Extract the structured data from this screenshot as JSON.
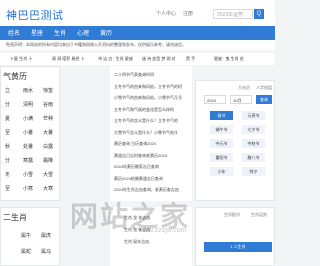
{
  "header": {
    "logo": "神巴巴测试",
    "search_placeholder": "2023年运势",
    "search_btn": "Q",
    "links": [
      "个人中心",
      "注册"
    ]
  },
  "nav": [
    "姓名",
    "星座",
    "生肖",
    "心理",
    "黄历"
  ],
  "notice": {
    "text": "免责声明：本网站的所有内容均来自于书籍和网络公开资料的整理和发布，仅供娱乐参考，请勿迷信。",
    "highlight": "仅供娱乐参考，请勿迷信。"
  },
  "tags": [
    "卜星 生肖 十",
    "周 测 塔罗 易经 卜 ",
    "冲 洁 白 · 生肖 星座",
    "迷 诗 血型 梦 测 对",
    "黑 手",
    "星座 · 鬼 生肖 花"
  ],
  "solar_terms": {
    "title": "气黄历",
    "grid": [
      [
        "立",
        "雨水",
        "惊蛰"
      ],
      [
        "分",
        "清明",
        "谷雨"
      ],
      [
        "夏",
        "小满",
        "芒种"
      ],
      [
        "至",
        "小暑",
        "大暑"
      ],
      [
        "秋",
        "处暑",
        "白露"
      ],
      [
        "分",
        "寒露",
        "霜降"
      ],
      [
        "冬",
        "小雪",
        "大雪"
      ],
      [
        "至",
        "小寒",
        "大寒"
      ]
    ]
  },
  "articles": {
    "title": "气黄历",
    "items": [
      "二十四节气表查询时间",
      "立冬节气的由来和风俗，立冬节气的时",
      "小雪节气的由来和风俗，小雪节气几号",
      "立冬节气和气候的变化是怎么样的",
      "立冬节气的含义是什么？立冬节气的",
      "大雪节气含义是什么？小寒节气吃什",
      "黄历查询 日历查询2024",
      "黄道吉日吉时查询老黄历2024",
      "2024年黄历搬家吉日查询",
      "黄历2024结婚黄道吉日查询",
      "2024年生肖吉凶查询，老黄历查吉凶"
    ]
  },
  "right": {
    "tab1": "万年历",
    "tab2": "八字排盘",
    "year": "2024",
    "month": "10月",
    "search_label": "查询",
    "jieqi": [
      "春节",
      "元宵节",
      "端午节",
      "七夕节",
      "中元节",
      "中秋节",
      "重阳节",
      "腊八节",
      "小年",
      "除夕"
    ]
  },
  "zodiac": {
    "title": "二生肖",
    "grid": [
      [
        "",
        "属牛",
        "属虎"
      ],
      [
        "",
        "属蛇",
        "属马"
      ]
    ],
    "articles": [
      "生肖 龙 年吉凶",
      "生肖 兔 年吉凶",
      "生肖 鼠年吉凶"
    ],
    "right_tabs": [
      "生肖配对",
      "生肖运势"
    ],
    "right_btn": "1 二生肖"
  },
  "watermark": {
    "text": "网站之家",
    "url": "www.zzzjw.com"
  }
}
